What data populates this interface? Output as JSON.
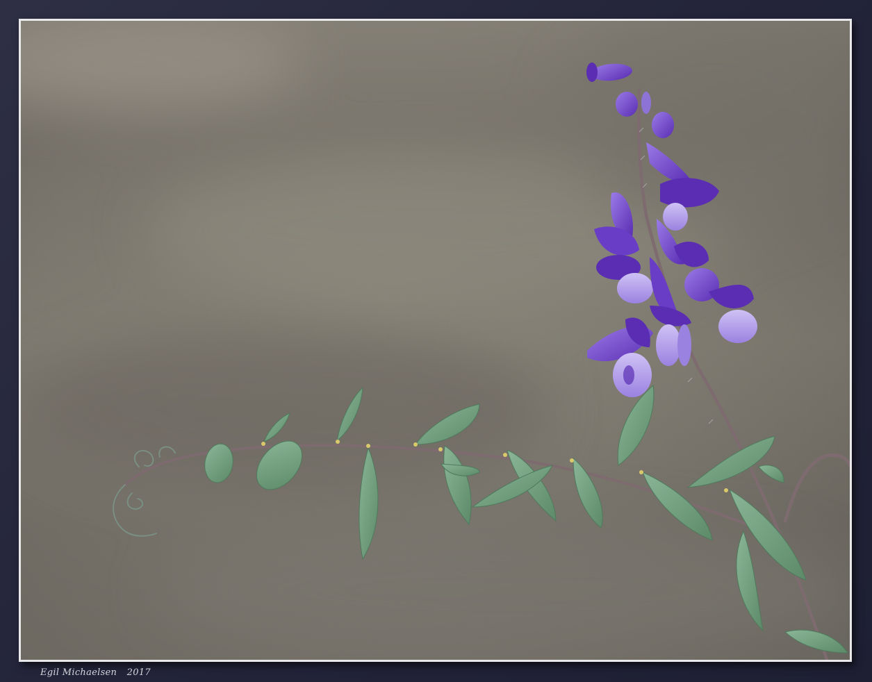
{
  "image": {
    "subject": "vetch-flower",
    "palette": {
      "frame": "#27283a",
      "border": "#e9e9ec",
      "background_light": "#8d8a80",
      "background_dark": "#5f5b55",
      "petal_dark": "#5b2bb5",
      "petal_mid": "#7e56d9",
      "petal_light": "#b9a6ee",
      "leaf": "#6e9a78",
      "leaf_light": "#8fb79a",
      "stem": "#7a6a6e"
    }
  },
  "watermark": {
    "author": "Egil Michaelsen",
    "year": "2017"
  }
}
